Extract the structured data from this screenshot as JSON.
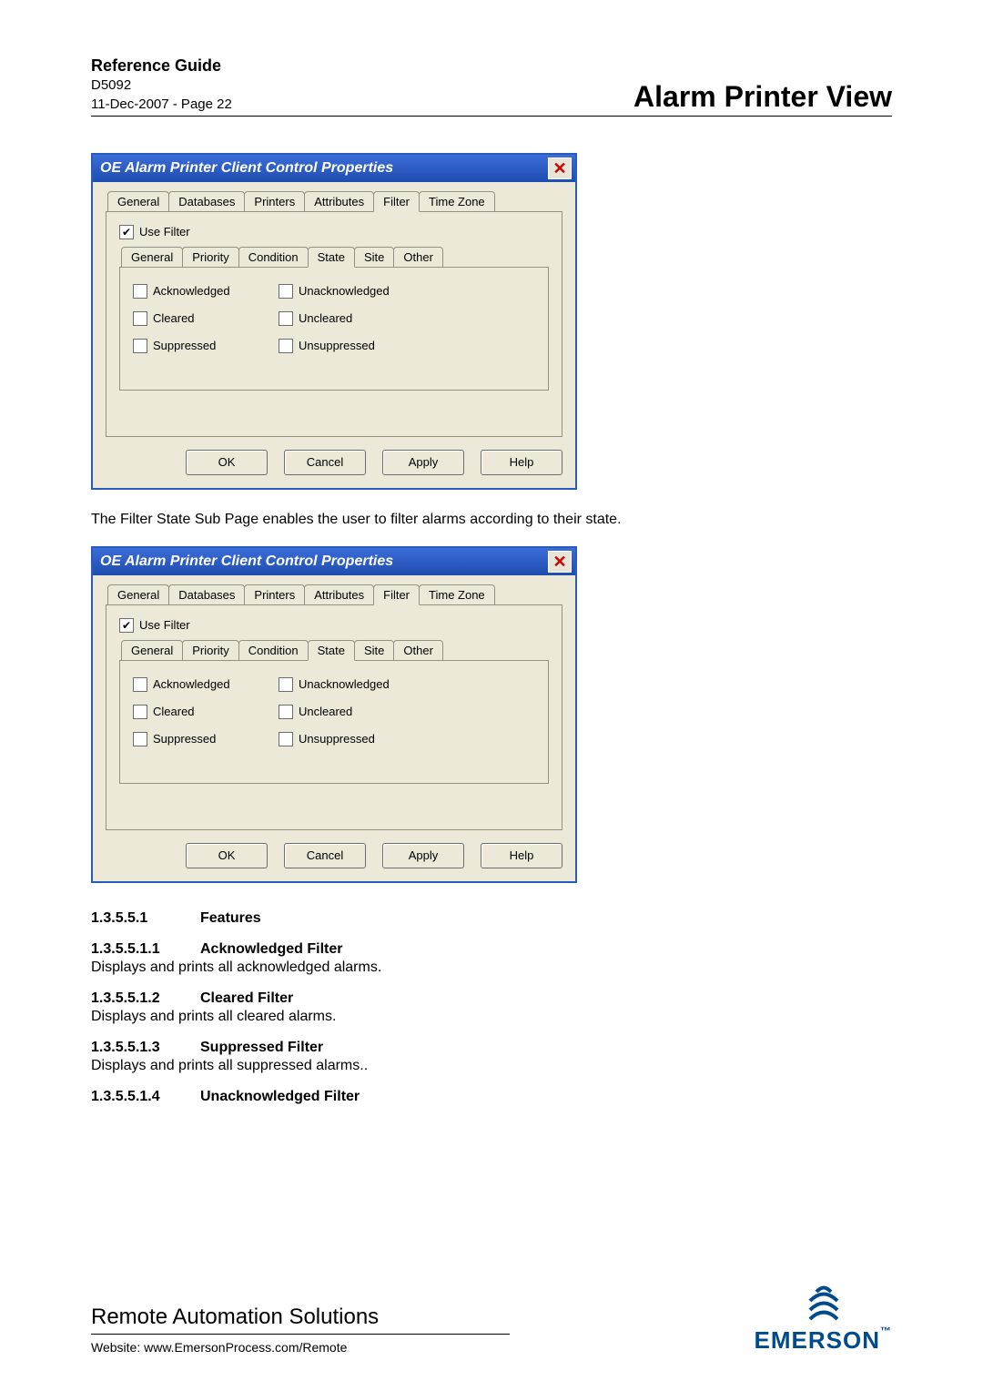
{
  "header": {
    "ref_guide": "Reference Guide",
    "doc_id": "D5092",
    "date_page": "11-Dec-2007 - Page 22",
    "section_title": "Alarm Printer View"
  },
  "dialog": {
    "title": "OE Alarm Printer Client Control Properties",
    "tabs": [
      "General",
      "Databases",
      "Printers",
      "Attributes",
      "Filter",
      "Time Zone"
    ],
    "active_tab": "Filter",
    "use_filter_label": "Use Filter",
    "inner_tabs": [
      "General",
      "Priority",
      "Condition",
      "State",
      "Site",
      "Other"
    ],
    "active_inner_tab": "State",
    "states": {
      "ack": "Acknowledged",
      "unack": "Unacknowledged",
      "cleared": "Cleared",
      "uncleared": "Uncleared",
      "suppressed": "Suppressed",
      "unsuppressed": "Unsuppressed"
    },
    "buttons": {
      "ok": "OK",
      "cancel": "Cancel",
      "apply": "Apply",
      "help": "Help"
    }
  },
  "body_text": "The Filter State Sub Page enables the user to filter alarms according to their state.",
  "features": {
    "head_num": "1.3.5.5.1",
    "head_title": "Features",
    "items": [
      {
        "num": "1.3.5.5.1.1",
        "title": "Acknowledged Filter",
        "desc": "Displays and prints all acknowledged alarms."
      },
      {
        "num": "1.3.5.5.1.2",
        "title": "Cleared Filter",
        "desc": "Displays and prints all cleared alarms."
      },
      {
        "num": "1.3.5.5.1.3",
        "title": "Suppressed Filter",
        "desc": "Displays and prints all suppressed alarms.."
      },
      {
        "num": "1.3.5.5.1.4",
        "title": "Unacknowledged Filter",
        "desc": ""
      }
    ]
  },
  "footer": {
    "company": "Remote Automation Solutions",
    "website": "Website:  www.EmersonProcess.com/Remote",
    "brand": "EMERSON",
    "tm": "™"
  }
}
